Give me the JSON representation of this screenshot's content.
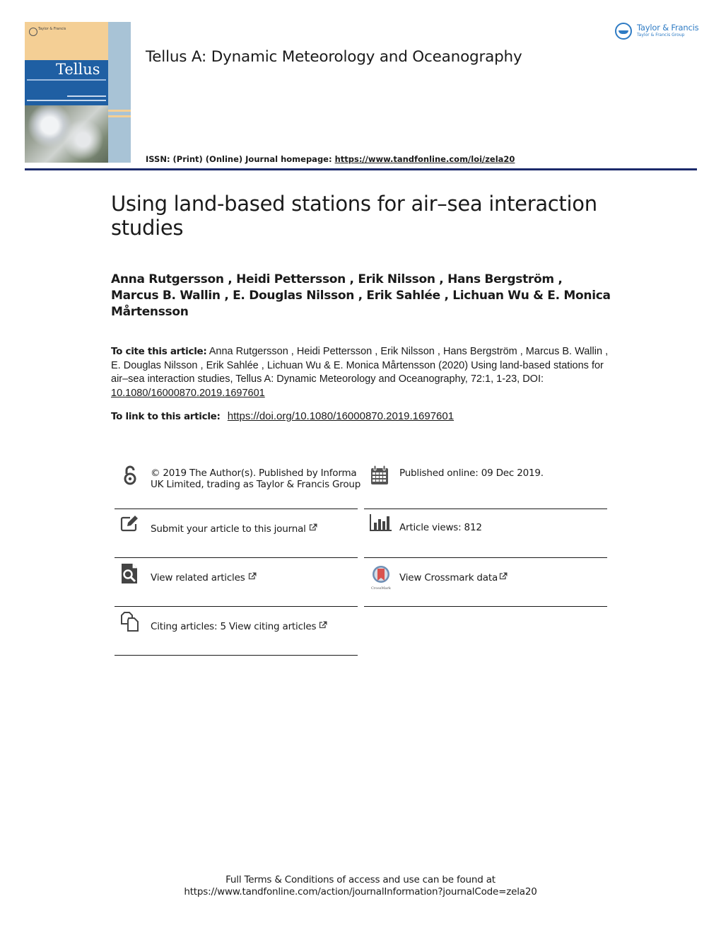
{
  "header": {
    "journal_title": "Tellus A: Dynamic Meteorology and Oceanography",
    "issn_text": "ISSN: (Print) (Online) Journal homepage: ",
    "homepage_url": "https://www.tandfonline.com/loi/zela20",
    "publisher_logo": {
      "name": "Taylor & Francis",
      "group": "Taylor & Francis Group",
      "color": "#2e7bc4"
    },
    "cover": {
      "title": "Tellus",
      "publisher": "Taylor & Francis"
    },
    "rule_color": "#1b2a6b"
  },
  "article": {
    "title": "Using land-based stations for air–sea interaction studies",
    "authors": "Anna Rutgersson , Heidi Pettersson , Erik Nilsson , Hans Bergström , Marcus B. Wallin , E. Douglas Nilsson , Erik Sahlée , Lichuan Wu & E. Monica Mårtensson",
    "cite_label": "To cite this article:",
    "cite_text": "Anna Rutgersson , Heidi Pettersson , Erik Nilsson , Hans Bergström , Marcus B. Wallin , E. Douglas Nilsson , Erik Sahlée , Lichuan Wu & E. Monica Mårtensson (2020) Using land-based stations for air–sea interaction studies, Tellus A: Dynamic Meteorology and Oceanography, 72:1, 1-23, DOI: ",
    "doi": "10.1080/16000870.2019.1697601",
    "link_label": "To link to this article:",
    "link_url": "https://doi.org/10.1080/16000870.2019.1697601"
  },
  "info": {
    "copyright": "© 2019 The Author(s). Published by Informa UK Limited, trading as Taylor & Francis Group",
    "published": "Published online: 09 Dec 2019.",
    "submit": "Submit your article to this journal",
    "views": "Article views: 812",
    "related": "View related articles",
    "crossmark": "View Crossmark data",
    "citing": "Citing articles: 5 View citing articles",
    "crossmark_caption": "CrossMark"
  },
  "footer": {
    "line1": "Full Terms & Conditions of access and use can be found at",
    "line2": "https://www.tandfonline.com/action/journalInformation?journalCode=zela20"
  }
}
